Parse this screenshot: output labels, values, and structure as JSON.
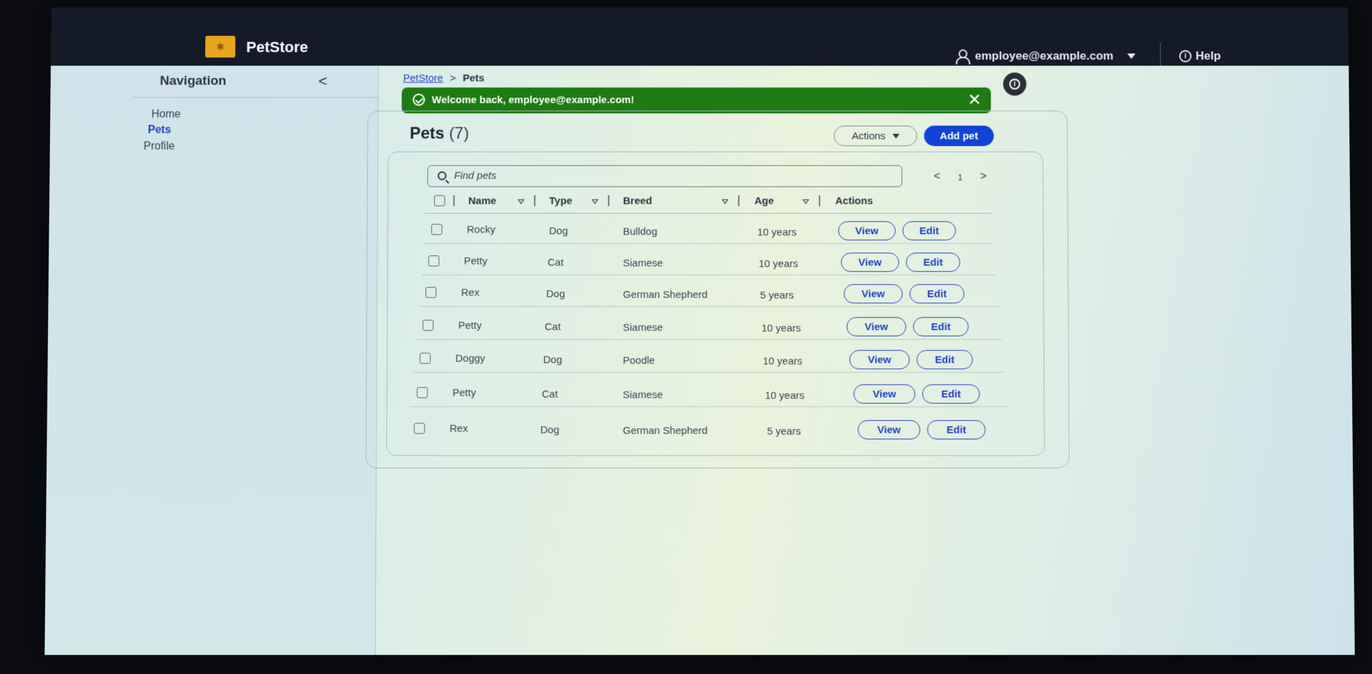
{
  "header": {
    "brand": "PetStore",
    "user_email": "employee@example.com",
    "help_label": "Help"
  },
  "nav": {
    "title": "Navigation",
    "collapse_glyph": "<",
    "items": [
      {
        "label": "Home",
        "active": false
      },
      {
        "label": "Pets",
        "active": true
      },
      {
        "label": "Profile",
        "active": false
      }
    ]
  },
  "breadcrumb": {
    "home": "PetStore",
    "separator": ">",
    "current": "Pets"
  },
  "alert": {
    "message": "Welcome back, employee@example.com!",
    "close_glyph": "✕",
    "color": "#1f7a14"
  },
  "page": {
    "title": "Pets",
    "count": "(7)",
    "actions_label": "Actions",
    "add_label": "Add pet",
    "accent": "#1343d6"
  },
  "search": {
    "placeholder": "Find pets"
  },
  "pager": {
    "prev": "<",
    "page": "1",
    "next": ">"
  },
  "table": {
    "columns": [
      "Name",
      "Type",
      "Breed",
      "Age",
      "Actions"
    ],
    "view_label": "View",
    "edit_label": "Edit",
    "rows": [
      {
        "name": "Rocky",
        "type": "Dog",
        "breed": "Bulldog",
        "age": "10 years"
      },
      {
        "name": "Petty",
        "type": "Cat",
        "breed": "Siamese",
        "age": "10 years"
      },
      {
        "name": "Rex",
        "type": "Dog",
        "breed": "German Shepherd",
        "age": "5 years"
      },
      {
        "name": "Petty",
        "type": "Cat",
        "breed": "Siamese",
        "age": "10 years"
      },
      {
        "name": "Doggy",
        "type": "Dog",
        "breed": "Poodle",
        "age": "10 years"
      },
      {
        "name": "Petty",
        "type": "Cat",
        "breed": "Siamese",
        "age": "10 years"
      },
      {
        "name": "Rex",
        "type": "Dog",
        "breed": "German Shepherd",
        "age": "5 years"
      }
    ]
  }
}
